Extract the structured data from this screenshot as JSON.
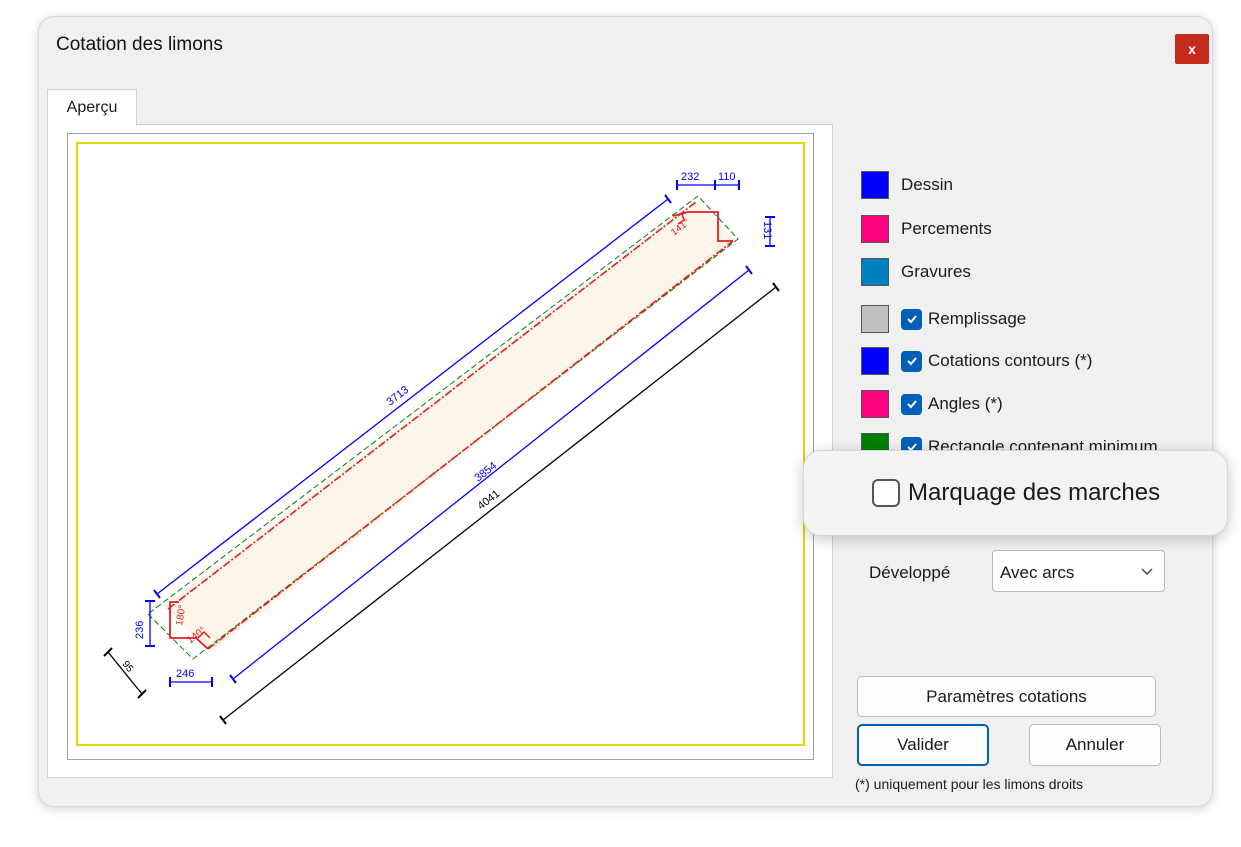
{
  "window": {
    "title": "Cotation des limons",
    "close_label": "x"
  },
  "tabs": [
    {
      "label": "Aperçu"
    }
  ],
  "drawing_labels": {
    "top_width_a": "232",
    "top_width_b": "110",
    "top_right_height": "131",
    "top_angle": "141°",
    "long_top": "3713",
    "mid_blue": "3854",
    "long_black": "4041",
    "left_height": "236",
    "left_angle_a": "180°",
    "left_angle_b": "140°",
    "bottom_width": "246",
    "diag_small": "95"
  },
  "legend": [
    {
      "label": "Dessin",
      "color": "#0000ff",
      "checkbox": false
    },
    {
      "label": "Percements",
      "color": "#ff0080",
      "checkbox": false
    },
    {
      "label": "Gravures",
      "color": "#0080c0",
      "checkbox": false
    },
    {
      "label": "Remplissage",
      "color": "#c0c0c0",
      "checkbox": true
    },
    {
      "label": "Cotations contours (*)",
      "color": "#0000ff",
      "checkbox": true
    },
    {
      "label": "Angles (*)",
      "color": "#ff0080",
      "checkbox": true
    },
    {
      "label": "Rectangle contenant minimum",
      "color": "#008000",
      "checkbox": true
    }
  ],
  "popout": {
    "label": "Marquage des marches",
    "checked": false
  },
  "developpe": {
    "label": "Développé",
    "value": "Avec arcs"
  },
  "buttons": {
    "parametres": "Paramètres cotations",
    "valider": "Valider",
    "annuler": "Annuler"
  },
  "footnote": "(*) uniquement pour les limons droits",
  "colors": {
    "accent": "#005fb8",
    "close": "#c42b1c",
    "frame": "#e0d800"
  }
}
